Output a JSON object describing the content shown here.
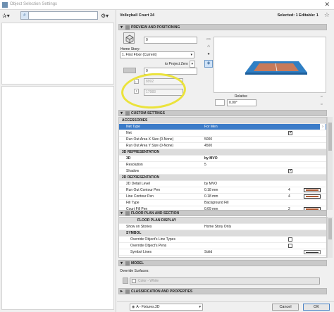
{
  "window": {
    "title": "Object Selection Settings"
  },
  "header": {
    "object_name": "Volleyball Court 24",
    "selected": "Selected: 1 Editable: 1"
  },
  "sections": {
    "preview": "PREVIEW AND POSITIONING",
    "custom": "CUSTOM SETTINGS",
    "floor_plan": "FLOOR PLAN AND SECTION",
    "model": "MODEL",
    "classification": "CLASSIFICATION AND PROPERTIES"
  },
  "positioning": {
    "elevation_value": "0",
    "home_story_label": "Home Story:",
    "home_story_value": "1. First Floor (Current)",
    "to_project_zero": "to Project Zero",
    "project_zero_value": "0",
    "width_value": "8992",
    "depth_value": "17983",
    "relative_label": "Relative",
    "angle_value": "0.00°"
  },
  "table": {
    "rows": [
      {
        "type": "group",
        "label": "ACCESSORIES"
      },
      {
        "type": "hl",
        "label": "Net Type",
        "value": "For Men"
      },
      {
        "type": "row",
        "label": "Net",
        "check": true
      },
      {
        "type": "row",
        "label": "Run Out Area X Size (0-None)",
        "value": "5000"
      },
      {
        "type": "row",
        "label": "Run Out Area Y Size (0-None)",
        "value": "4500"
      },
      {
        "type": "group",
        "label": "3D REPRESENTATION"
      },
      {
        "type": "row",
        "label": "3D",
        "value": "by MVO",
        "bold": true
      },
      {
        "type": "row",
        "label": "Resolution",
        "value": "5"
      },
      {
        "type": "row",
        "label": "Shadow",
        "check": true
      },
      {
        "type": "group",
        "label": "2D REPRESENTATION"
      },
      {
        "type": "row",
        "label": "2D Detail Level",
        "value": "by MVO"
      },
      {
        "type": "row",
        "label": "Run Out Contour Pen",
        "value": "0.18 mm",
        "penno": "4"
      },
      {
        "type": "row",
        "label": "Line Contour Pen",
        "value": "0.18 mm",
        "penno": "4"
      },
      {
        "type": "row",
        "label": "Fill Type",
        "value": "Background Fill"
      },
      {
        "type": "row",
        "label": "Court Fill Pen",
        "value": "0.09 mm",
        "penno": "2"
      }
    ]
  },
  "floor_plan_rows": {
    "display": "FLOOR PLAN DISPLAY",
    "show_on_stories": "Show on Stories",
    "show_on_stories_value": "Home Story Only",
    "symbol": "SYMBOL",
    "override_line_types": "Override Object's Line Types",
    "override_pens": "Override Object's Pens",
    "symbol_lines": "Symbol Lines",
    "symbol_lines_value": "Solid"
  },
  "model": {
    "override_surfaces": "Override Surfaces:",
    "surface_value": "Color - White"
  },
  "footer": {
    "layer_value": "A - Fixtures.3D",
    "cancel": "Cancel",
    "ok": "OK"
  },
  "colors": {
    "court": "#c77a5a",
    "runout": "#2f7fc4",
    "accent": "#3b7bc8"
  }
}
